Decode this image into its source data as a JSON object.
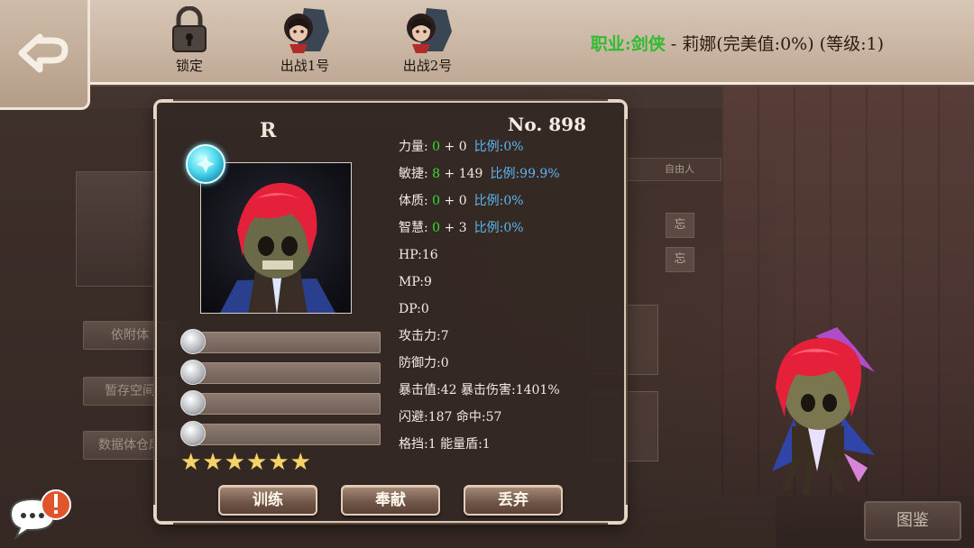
{
  "topbar": {
    "items": [
      {
        "label": "锁定",
        "icon": "lock-icon"
      },
      {
        "label": "出战1号",
        "icon": "character-portrait-icon"
      },
      {
        "label": "出战2号",
        "icon": "character-portrait-icon"
      }
    ],
    "char_info": {
      "class_label": "职业:剑侠",
      "separator": " - ",
      "detail": "莉娜(完美值:0%) (等级:1)"
    }
  },
  "background": {
    "side_buttons": [
      "依附体",
      "暂存空间",
      "数据体仓库"
    ],
    "table_header": "自由人",
    "forget_label": "忘",
    "atlas_button": "图鉴"
  },
  "card": {
    "rarity": "R",
    "number": "No. 898",
    "star_count": 6,
    "star_glyph": "★",
    "stats": [
      {
        "label": "力量:",
        "base": "0",
        "bonus": " + 0",
        "ratio": "比例:0%"
      },
      {
        "label": "敏捷:",
        "base": "8",
        "bonus": " + 149",
        "ratio": "比例:99.9%"
      },
      {
        "label": "体质:",
        "base": "0",
        "bonus": " + 0",
        "ratio": "比例:0%"
      },
      {
        "label": "智慧:",
        "base": "0",
        "bonus": " + 3",
        "ratio": "比例:0%"
      }
    ],
    "plain_stats": [
      "HP:16",
      "MP:9",
      "DP:0",
      "攻击力:7",
      "防御力:0",
      "暴击值:42  暴击伤害:1401%",
      "闪避:187  命中:57",
      "格挡:1  能量盾:1"
    ],
    "buttons": {
      "train": "训练",
      "contribute": "奉献",
      "discard": "丢弃"
    }
  },
  "colors": {
    "green": "#32e132",
    "blue": "#5bb8f5",
    "class_green": "#2fbd2f",
    "star": "#f5d36b"
  }
}
